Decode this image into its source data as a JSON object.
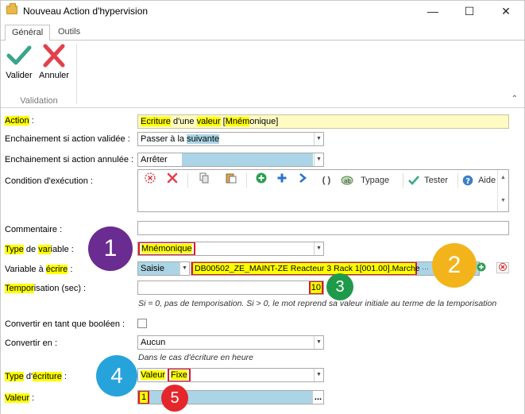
{
  "window": {
    "title": "Nouveau Action d'hypervision"
  },
  "ribbon": {
    "tabs": [
      "Général",
      "Outils"
    ],
    "valider": "Valider",
    "annuler": "Annuler",
    "group": "Validation"
  },
  "form": {
    "action": {
      "label_hl": "Action",
      "label_rest": " :",
      "value_parts": [
        "Ecriture",
        " d'une ",
        "valeur",
        " [",
        "Mném",
        "onique]"
      ]
    },
    "enchainement_validee": {
      "label": "Enchainement si action validée :",
      "value_a": "Passer à la ",
      "value_b": "suivante"
    },
    "enchainement_annulee": {
      "label": "Enchainement si action annulée :",
      "value": "Arrêter"
    },
    "condition": {
      "label": "Condition d'exécution :",
      "typage": "Typage",
      "tester": "Tester",
      "aide": "Aide",
      "parens": "( )"
    },
    "commentaire": {
      "label": "Commentaire :",
      "value": ""
    },
    "type_variable": {
      "l1": "Type",
      "l2": " de ",
      "l3": "var",
      "l4": "iable :",
      "value": "Mnémonique"
    },
    "variable_ecrire": {
      "l1": "Variable à ",
      "l2": "écrire",
      "l3": " :",
      "mode": "Saisie",
      "value": "DB00502_ZE_MAINT-ZE Reacteur 3 Rack 1[001.00].Marche",
      "ellipsis": "···"
    },
    "temporisation": {
      "l1": "Tempor",
      "l2": "isation (sec) :",
      "value": "10",
      "hint": "Si = 0, pas de temporisation. Si > 0, le mot reprend sa valeur initiale au terme de la temporisation"
    },
    "booleen": {
      "label": "Convertir en tant que booléen :"
    },
    "convertir": {
      "label": "Convertir en :",
      "value": "Aucun",
      "hint": "Dans le cas d'écriture en heure"
    },
    "type_ecriture": {
      "l1": "Type",
      "l2": " d'",
      "l3": "écriture",
      "l4": " :",
      "v1": "Valeur",
      "v2": "Fixe"
    },
    "valeur": {
      "l1": "Valeur",
      "l2": " :",
      "value": "1",
      "ellipsis": "..."
    }
  },
  "badges": {
    "b1": "1",
    "b2": "2",
    "b3": "3",
    "b4": "4",
    "b5": "5"
  },
  "colors": {
    "purple": "#6a2c91",
    "orange": "#f3b41b",
    "green": "#1f9a4a",
    "blue": "#27a3dc",
    "red": "#e5262b",
    "highlight": "#ffff00",
    "blueField": "#abd5e6"
  }
}
